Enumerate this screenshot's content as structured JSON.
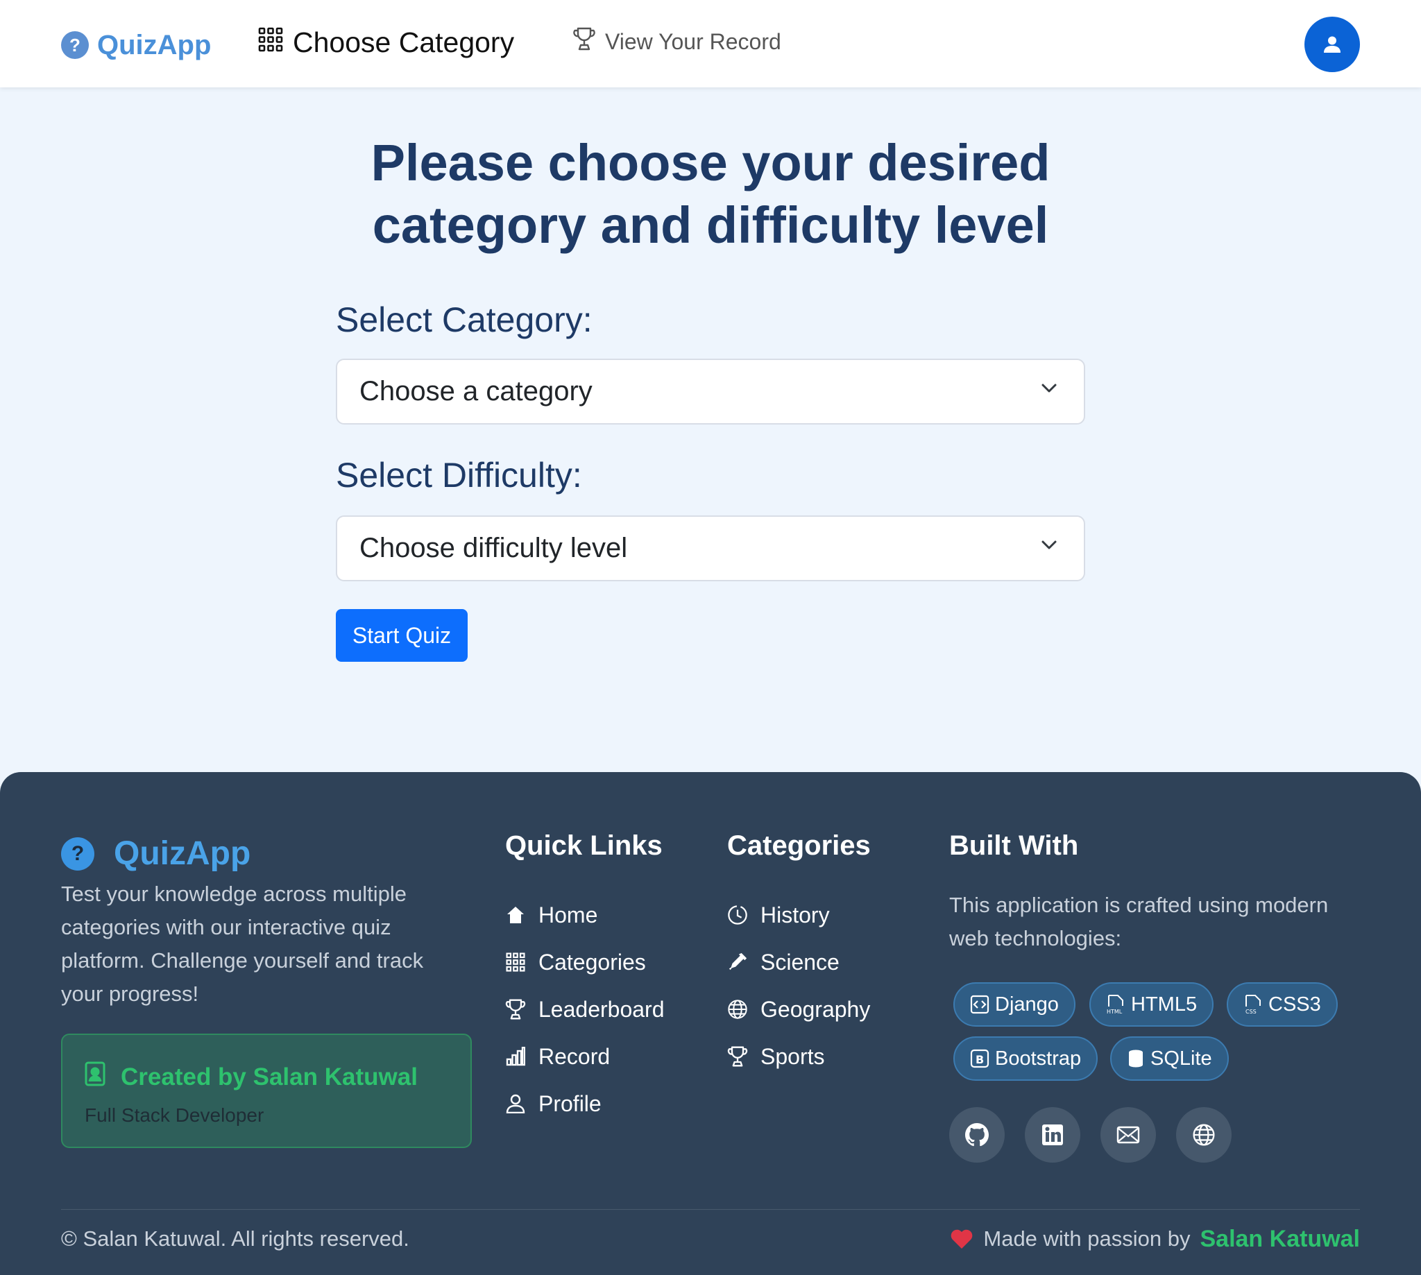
{
  "navbar": {
    "brand": "QuizApp",
    "brand_icon": "question-circle-icon",
    "choose_category": "Choose Category",
    "view_record": "View Your Record"
  },
  "main": {
    "heading": "Please choose your desired category and difficulty level",
    "category_label": "Select Category:",
    "category_placeholder": "Choose a category",
    "difficulty_label": "Select Difficulty:",
    "difficulty_placeholder": "Choose difficulty level",
    "start_button": "Start Quiz"
  },
  "footer": {
    "brand": "QuizApp",
    "description": "Test your knowledge across multiple categories with our interactive quiz platform. Challenge yourself and track your progress!",
    "creator_title": "Created by Salan Katuwal",
    "creator_role": "Full Stack Developer",
    "quick_links": {
      "title": "Quick Links",
      "items": [
        {
          "label": "Home",
          "icon": "house-icon"
        },
        {
          "label": "Categories",
          "icon": "grid-icon"
        },
        {
          "label": "Leaderboard",
          "icon": "trophy-icon"
        },
        {
          "label": "Record",
          "icon": "bar-chart-icon"
        },
        {
          "label": "Profile",
          "icon": "person-icon"
        }
      ]
    },
    "categories": {
      "title": "Categories",
      "items": [
        {
          "label": "History",
          "icon": "clock-icon"
        },
        {
          "label": "Science",
          "icon": "pipette-icon"
        },
        {
          "label": "Geography",
          "icon": "globe-icon"
        },
        {
          "label": "Sports",
          "icon": "trophy-icon"
        }
      ]
    },
    "built_with": {
      "title": "Built With",
      "description": "This application is crafted using modern web technologies:",
      "tech": [
        "Django",
        "HTML5",
        "CSS3",
        "Bootstrap",
        "SQLite"
      ]
    },
    "social_icons": [
      "github-icon",
      "linkedin-icon",
      "envelope-icon",
      "globe-icon"
    ],
    "copyright": "© Salan Katuwal. All rights reserved.",
    "made_with": "Made with passion by",
    "made_by": "Salan Katuwal"
  },
  "colors": {
    "primary": "#0d6efd",
    "heading": "#1e3a66",
    "footer_bg": "#2f4258",
    "accent_green": "#2ec26e",
    "brand_blue": "#4a90d9",
    "heart": "#e03546"
  }
}
